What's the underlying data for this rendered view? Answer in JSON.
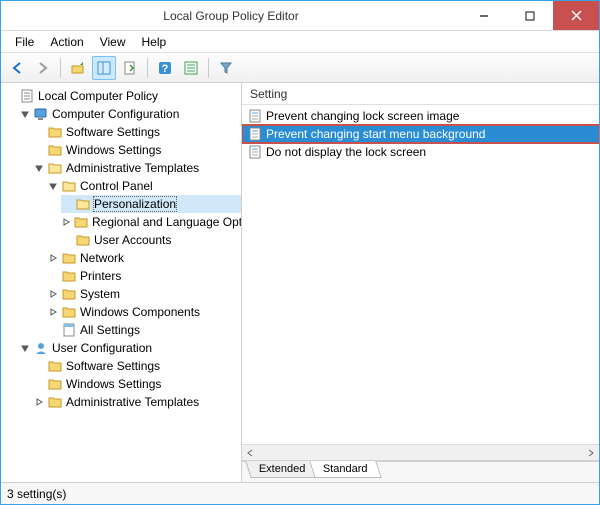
{
  "window": {
    "title": "Local Group Policy Editor"
  },
  "menu": {
    "items": [
      "File",
      "Action",
      "View",
      "Help"
    ]
  },
  "tree": {
    "root": {
      "label": "Local Computer Policy",
      "children": [
        {
          "label": "Computer Configuration",
          "expanded": true,
          "children": [
            {
              "label": "Software Settings"
            },
            {
              "label": "Windows Settings"
            },
            {
              "label": "Administrative Templates",
              "expanded": true,
              "children": [
                {
                  "label": "Control Panel",
                  "expanded": true,
                  "children": [
                    {
                      "label": "Personalization",
                      "selected": true
                    },
                    {
                      "label": "Regional and Language Options",
                      "expandable": true
                    },
                    {
                      "label": "User Accounts"
                    }
                  ]
                },
                {
                  "label": "Network",
                  "expandable": true
                },
                {
                  "label": "Printers"
                },
                {
                  "label": "System",
                  "expandable": true
                },
                {
                  "label": "Windows Components",
                  "expandable": true
                },
                {
                  "label": "All Settings",
                  "leafIcon": "sheet"
                }
              ]
            }
          ]
        },
        {
          "label": "User Configuration",
          "expanded": true,
          "children": [
            {
              "label": "Software Settings"
            },
            {
              "label": "Windows Settings"
            },
            {
              "label": "Administrative Templates",
              "expandable": true
            }
          ]
        }
      ]
    }
  },
  "list": {
    "header": "Setting",
    "items": [
      {
        "label": "Prevent changing lock screen image"
      },
      {
        "label": "Prevent changing start menu background",
        "selected": true
      },
      {
        "label": "Do not display the lock screen"
      }
    ],
    "tabs": {
      "extended": "Extended",
      "standard": "Standard",
      "active": "standard"
    }
  },
  "status": {
    "text": "3 setting(s)"
  }
}
